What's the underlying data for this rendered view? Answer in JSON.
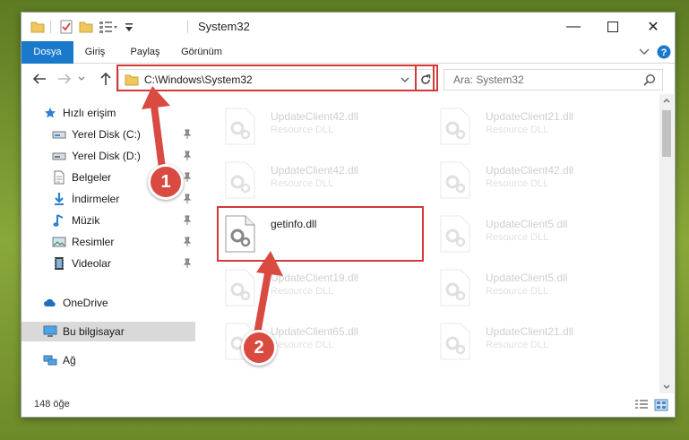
{
  "window": {
    "title": "System32"
  },
  "ribbon": {
    "tabs": [
      "Dosya",
      "Giriş",
      "Paylaş",
      "Görünüm"
    ]
  },
  "address": {
    "path": "C:\\Windows\\System32",
    "search_placeholder": "Ara: System32"
  },
  "nav": {
    "quick_access": "Hızlı erişim",
    "items": [
      {
        "label": "Yerel Disk (C:)",
        "icon": "drive-icon"
      },
      {
        "label": "Yerel Disk (D:)",
        "icon": "drive-icon"
      },
      {
        "label": "Belgeler",
        "icon": "documents-icon"
      },
      {
        "label": "İndirmeler",
        "icon": "downloads-icon"
      },
      {
        "label": "Müzik",
        "icon": "music-icon"
      },
      {
        "label": "Resimler",
        "icon": "pictures-icon"
      },
      {
        "label": "Videolar",
        "icon": "videos-icon"
      }
    ],
    "onedrive": "OneDrive",
    "this_pc": "Bu bilgisayar",
    "network": "Ağ"
  },
  "files": [
    {
      "name": "UpdateClient42.dll",
      "desc": "Resource DLL"
    },
    {
      "name": "UpdateClient21.dll",
      "desc": "Resource DLL"
    },
    {
      "name": "UpdateClient42.dll",
      "desc": "Resource DLL"
    },
    {
      "name": "UpdateClient42.dll",
      "desc": "Resource DLL"
    },
    {
      "name": "getinfo.dll",
      "desc": ""
    },
    {
      "name": "UpdateClient5.dll",
      "desc": "Resource DLL"
    },
    {
      "name": "UpdateClient19.dll",
      "desc": "Resource DLL"
    },
    {
      "name": "UpdateClient5.dll",
      "desc": "Resource DLL"
    },
    {
      "name": "UpdateClient65.dll",
      "desc": "Resource DLL"
    },
    {
      "name": "UpdateClient21.dll",
      "desc": "Resource DLL"
    }
  ],
  "status": {
    "count": "148 öğe"
  },
  "annotations": {
    "step1": "1",
    "step2": "2"
  },
  "colors": {
    "accent": "#1979ca",
    "highlight": "#d23a3a",
    "badge": "#d94a41"
  }
}
